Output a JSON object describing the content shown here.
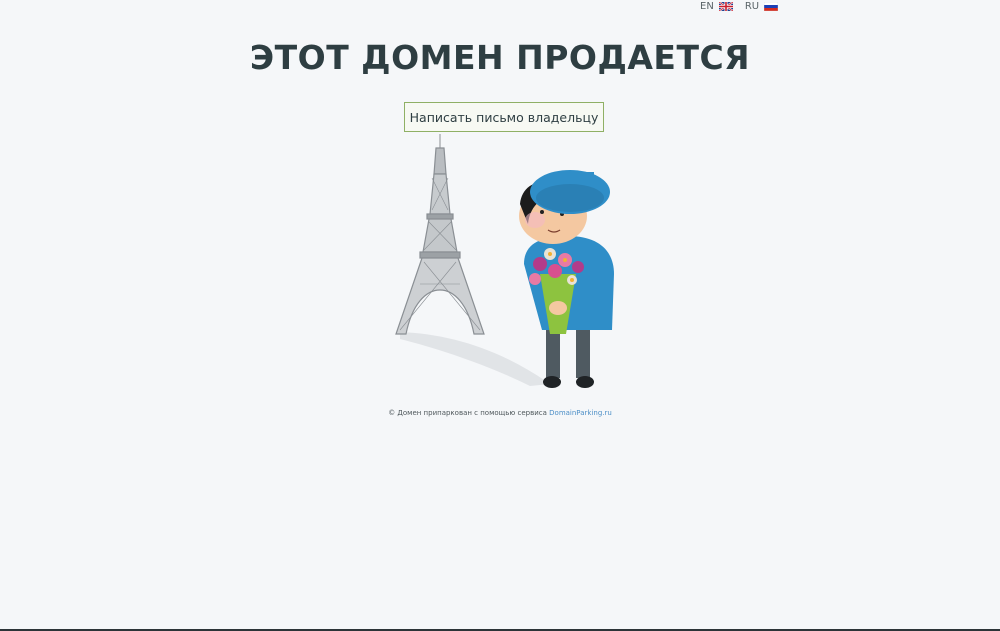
{
  "languages": [
    {
      "code": "EN",
      "flag": "uk-flag-icon"
    },
    {
      "code": "RU",
      "flag": "russia-flag-icon"
    }
  ],
  "title": "ЭТОТ ДОМЕН ПРОДАЕТСЯ",
  "contact_button": "Написать письмо владельцу",
  "illustration": {
    "tower": "eiffel-tower-icon",
    "character": "boy-with-flowers-icon"
  },
  "footer": {
    "text": "© Домен припаркован с помощью сервиса ",
    "link": "DomainParking.ru"
  },
  "colors": {
    "background": "#f5f7f9",
    "title": "#2e3e42",
    "button_border": "#8fb065",
    "link": "#4d8fc7",
    "beret": "#2f8ec8"
  }
}
